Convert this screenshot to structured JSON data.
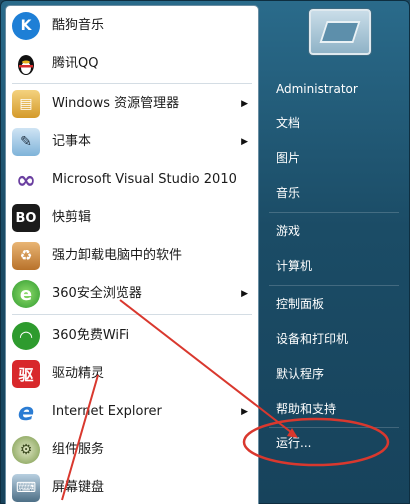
{
  "start_menu": {
    "programs": [
      {
        "label": "酷狗音乐",
        "icon": "kugou-music-icon",
        "icon_char": "K",
        "icon_color": "#1e7fd6",
        "has_submenu": false
      },
      {
        "label": "腾讯QQ",
        "icon": "qq-penguin-icon",
        "icon_char": "🐧",
        "icon_color": "#ffffff",
        "has_submenu": false
      },
      {
        "label": "Windows 资源管理器",
        "icon": "explorer-folder-icon",
        "icon_char": "▤",
        "icon_color": "#e4b64a",
        "has_submenu": true
      },
      {
        "label": "记事本",
        "icon": "notepad-icon",
        "icon_char": "✎",
        "icon_color": "#7fb3d9",
        "has_submenu": true
      },
      {
        "label": "Microsoft Visual Studio 2010",
        "icon": "visual-studio-icon",
        "icon_char": "∞",
        "icon_color": "#6a3fa0",
        "has_submenu": false
      },
      {
        "label": "快剪辑",
        "icon": "kuaijianji-icon",
        "icon_char": "B",
        "icon_color": "#222222",
        "has_submenu": false
      },
      {
        "label": "强力卸载电脑中的软件",
        "icon": "uninstall-box-icon",
        "icon_char": "♻",
        "icon_color": "#c9822f",
        "has_submenu": false
      },
      {
        "label": "360安全浏览器",
        "icon": "360-browser-icon",
        "icon_char": "e",
        "icon_color": "#3aa83a",
        "has_submenu": true
      },
      {
        "label": "360免费WiFi",
        "icon": "360-wifi-icon",
        "icon_char": "◠",
        "icon_color": "#2e9b2e",
        "has_submenu": false
      },
      {
        "label": "驱动精灵",
        "icon": "driver-genius-icon",
        "icon_char": "驱",
        "icon_color": "#d8282b",
        "has_submenu": false
      },
      {
        "label": "Internet Explorer",
        "icon": "internet-explorer-icon",
        "icon_char": "e",
        "icon_color": "#2b7cd3",
        "has_submenu": true
      },
      {
        "label": "组件服务",
        "icon": "component-services-icon",
        "icon_char": "⚙",
        "icon_color": "#7a9a4a",
        "has_submenu": false
      },
      {
        "label": "屏幕键盘",
        "icon": "on-screen-keyboard-icon",
        "icon_char": "⌨",
        "icon_color": "#4d6f86",
        "has_submenu": false
      }
    ],
    "right": {
      "user": "Administrator",
      "items": [
        "文档",
        "图片",
        "音乐",
        "游戏",
        "计算机",
        "控制面板",
        "设备和打印机",
        "默认程序",
        "帮助和支持",
        "运行..."
      ]
    }
  },
  "annotation_color": "#d9382e"
}
